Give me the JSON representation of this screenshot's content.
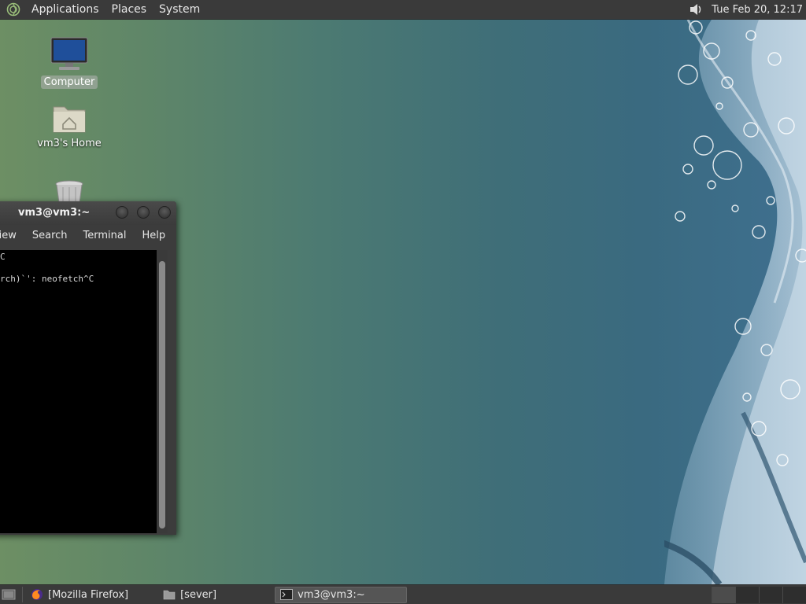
{
  "top_panel": {
    "menus": [
      "Applications",
      "Places",
      "System"
    ],
    "clock": "Tue Feb 20, 12:17"
  },
  "desktop": {
    "icons": [
      {
        "label": "Computer"
      },
      {
        "label": "vm3's Home"
      },
      {
        "label": ""
      }
    ]
  },
  "terminal": {
    "title": "vm3@vm3:~",
    "menus": [
      "View",
      "Search",
      "Terminal",
      "Help"
    ],
    "lines": [
      "C",
      "",
      "rch)`': neofetch^C"
    ]
  },
  "taskbar": {
    "tasks": [
      "[Mozilla Firefox]",
      "[sever]",
      "vm3@vm3:~"
    ]
  },
  "colors": {
    "panel_bg": "#3a3a3a",
    "terminal_bg": "#000000"
  }
}
